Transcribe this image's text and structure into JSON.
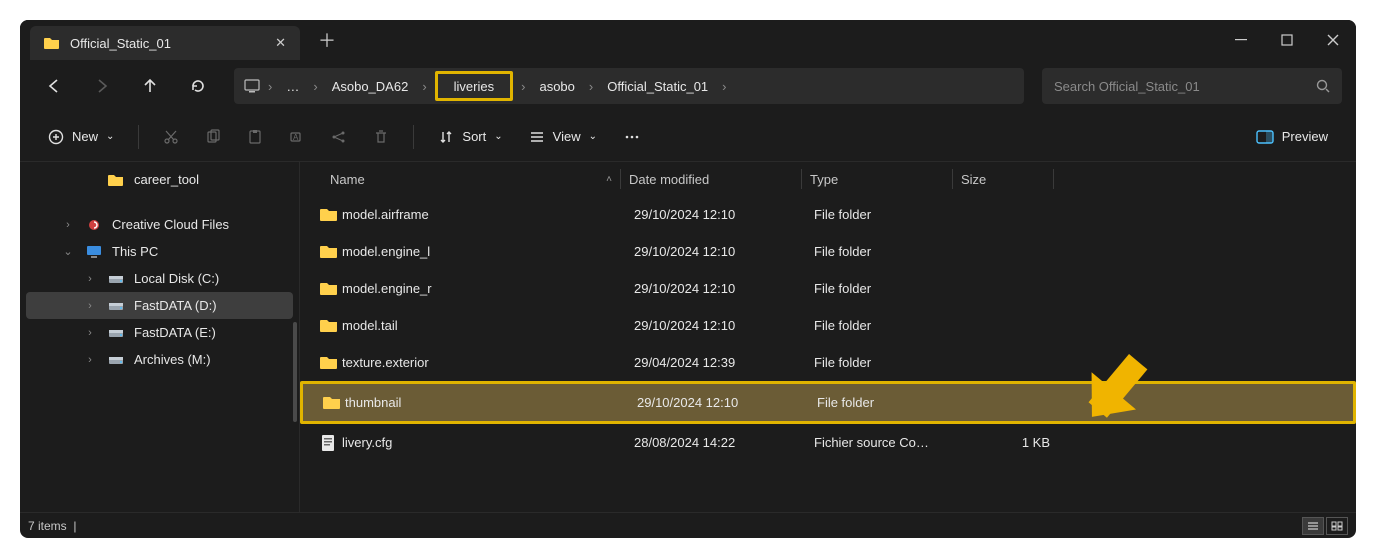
{
  "titlebar": {
    "tabTitle": "Official_Static_01"
  },
  "breadcrumb": {
    "items": [
      "Asobo_DA62",
      "liveries",
      "asobo",
      "Official_Static_01"
    ],
    "highlightIndex": 1
  },
  "search": {
    "placeholder": "Search Official_Static_01"
  },
  "toolbar": {
    "new": "New",
    "sort": "Sort",
    "view": "View",
    "preview": "Preview"
  },
  "sidebar": {
    "items": [
      {
        "label": "career_tool",
        "type": "folder",
        "level": 2,
        "chev": "none"
      },
      {
        "label": "Creative Cloud Files",
        "type": "cloud",
        "level": 1,
        "chev": "right"
      },
      {
        "label": "This PC",
        "type": "pc",
        "level": 1,
        "chev": "down"
      },
      {
        "label": "Local Disk (C:)",
        "type": "drive",
        "level": 2,
        "chev": "right"
      },
      {
        "label": "FastDATA (D:)",
        "type": "drive",
        "level": 2,
        "chev": "right",
        "selected": true
      },
      {
        "label": "FastDATA (E:)",
        "type": "drive",
        "level": 2,
        "chev": "right"
      },
      {
        "label": "Archives (M:)",
        "type": "drive",
        "level": 2,
        "chev": "right"
      }
    ]
  },
  "columns": {
    "name": "Name",
    "date": "Date modified",
    "type": "Type",
    "size": "Size"
  },
  "files": [
    {
      "name": "model.airframe",
      "date": "29/10/2024 12:10",
      "type": "File folder",
      "size": "",
      "icon": "folder"
    },
    {
      "name": "model.engine_l",
      "date": "29/10/2024 12:10",
      "type": "File folder",
      "size": "",
      "icon": "folder"
    },
    {
      "name": "model.engine_r",
      "date": "29/10/2024 12:10",
      "type": "File folder",
      "size": "",
      "icon": "folder"
    },
    {
      "name": "model.tail",
      "date": "29/10/2024 12:10",
      "type": "File folder",
      "size": "",
      "icon": "folder"
    },
    {
      "name": "texture.exterior",
      "date": "29/04/2024 12:39",
      "type": "File folder",
      "size": "",
      "icon": "folder"
    },
    {
      "name": "thumbnail",
      "date": "29/10/2024 12:10",
      "type": "File folder",
      "size": "",
      "icon": "folder",
      "selected": true
    },
    {
      "name": "livery.cfg",
      "date": "28/08/2024 14:22",
      "type": "Fichier source Co…",
      "size": "1 KB",
      "icon": "cfg"
    }
  ],
  "status": {
    "count": "7 items"
  }
}
